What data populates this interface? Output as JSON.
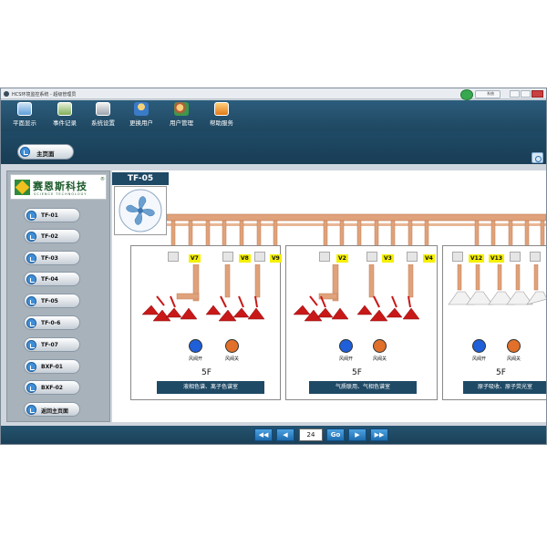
{
  "window": {
    "title": "HCS环境监控系统 - 超级管理员",
    "system_text": "系统"
  },
  "toolbar": {
    "items": [
      {
        "label": "平面显示",
        "icon": "monitor-icon"
      },
      {
        "label": "事件记录",
        "icon": "event-log-icon"
      },
      {
        "label": "系统设置",
        "icon": "settings-icon"
      },
      {
        "label": "更换用户",
        "icon": "switch-user-icon"
      },
      {
        "label": "用户管理",
        "icon": "user-management-icon"
      },
      {
        "label": "帮助服务",
        "icon": "help-icon"
      }
    ]
  },
  "nav": {
    "home_label": "主页面"
  },
  "logo": {
    "name": "赛恩斯科技",
    "subtitle": "SCIENCE TECHNOLOGY",
    "mark": "®"
  },
  "sidebar": {
    "items": [
      {
        "label": "TF-01"
      },
      {
        "label": "TF-02"
      },
      {
        "label": "TF-03"
      },
      {
        "label": "TF-04"
      },
      {
        "label": "TF-05"
      },
      {
        "label": "TF-0-6"
      },
      {
        "label": "TF-07"
      },
      {
        "label": "BXF-01"
      },
      {
        "label": "BXF-02"
      },
      {
        "label": "返回主页面"
      }
    ]
  },
  "main": {
    "fan_title": "TF-05",
    "rooms": [
      {
        "floor": "5F",
        "name": "液相色谱、离子色谱室",
        "valves": [
          "V7",
          "V8",
          "V9"
        ],
        "indicator_open_label": "风阀开",
        "indicator_close_label": "风阀关",
        "open_color": "#1f5fd8",
        "close_color": "#e0702a"
      },
      {
        "floor": "5F",
        "name": "气质联用、气相色谱室",
        "valves": [
          "V2",
          "V3",
          "V4"
        ],
        "indicator_open_label": "风阀开",
        "indicator_close_label": "风阀关",
        "open_color": "#1f5fd8",
        "close_color": "#e0702a"
      },
      {
        "floor": "5F",
        "name": "原子吸收、原子荧光室",
        "valves": [
          "V12",
          "V13"
        ],
        "indicator_open_label": "风阀开",
        "indicator_close_label": "风阀关",
        "open_color": "#1f5fd8",
        "close_color": "#e0702a"
      }
    ]
  },
  "pager": {
    "first": "◀◀",
    "prev": "◀",
    "page": "24",
    "go": "Go",
    "next": "▶",
    "last": "▶▶"
  },
  "colors": {
    "pipe": "#e0a27a",
    "hood_red": "#c81818",
    "header_blue": "#1f4a66",
    "valve_yellow": "#f5f000"
  }
}
